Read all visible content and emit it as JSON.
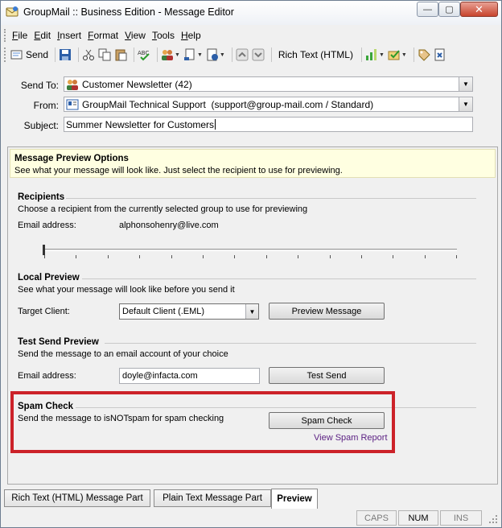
{
  "window": {
    "title": "GroupMail :: Business Edition - Message Editor",
    "controls": {
      "minimize": "—",
      "maximize": "▢",
      "close": "✕"
    }
  },
  "menubar": [
    {
      "label": "File",
      "key": "F",
      "rest": "ile"
    },
    {
      "label": "Edit",
      "key": "E",
      "rest": "dit"
    },
    {
      "label": "Insert",
      "key": "I",
      "rest": "nsert"
    },
    {
      "label": "Format",
      "key": "F",
      "rest": "ormat"
    },
    {
      "label": "View",
      "key": "V",
      "rest": "iew"
    },
    {
      "label": "Tools",
      "key": "T",
      "rest": "ools"
    },
    {
      "label": "Help",
      "key": "H",
      "rest": "elp"
    }
  ],
  "toolbar": {
    "send_label": "Send",
    "format_label": "Rich Text (HTML)"
  },
  "header": {
    "send_to_label": "Send To:",
    "send_to_value": "Customer Newsletter (42)",
    "from_label": "From:",
    "from_value": "GroupMail Technical Support  (support@group-mail.com / Standard)",
    "subject_label": "Subject:",
    "subject_value": "Summer Newsletter for Customers"
  },
  "preview": {
    "banner_title": "Message Preview Options",
    "banner_text": "See what your message will look like. Just select the recipient to use for previewing.",
    "recipients": {
      "title": "Recipients",
      "desc": "Choose a recipient from the currently selected group to use for previewing",
      "email_label": "Email address:",
      "email_value": "alphonsohenry@live.com",
      "slider_position": 0
    },
    "local": {
      "title": "Local Preview",
      "desc": "See what your message will look like before you send it",
      "target_label": "Target Client:",
      "target_value": "Default Client (.EML)",
      "button": "Preview Message"
    },
    "test_send": {
      "title": "Test Send Preview",
      "desc": "Send the message to an email account of your choice",
      "email_label": "Email address:",
      "email_value": "doyle@infacta.com",
      "button": "Test Send"
    },
    "spam": {
      "title": "Spam Check",
      "desc": "Send the message to isNOTspam for spam checking",
      "button": "Spam Check",
      "link": "View Spam Report",
      "highlight_color": "#cc2229"
    }
  },
  "tabs": [
    {
      "label": "Rich Text (HTML) Message Part",
      "active": false
    },
    {
      "label": "Plain Text Message Part",
      "active": false
    },
    {
      "label": "Preview",
      "active": true
    }
  ],
  "status": {
    "caps": "CAPS",
    "num": "NUM",
    "ins": "INS"
  }
}
